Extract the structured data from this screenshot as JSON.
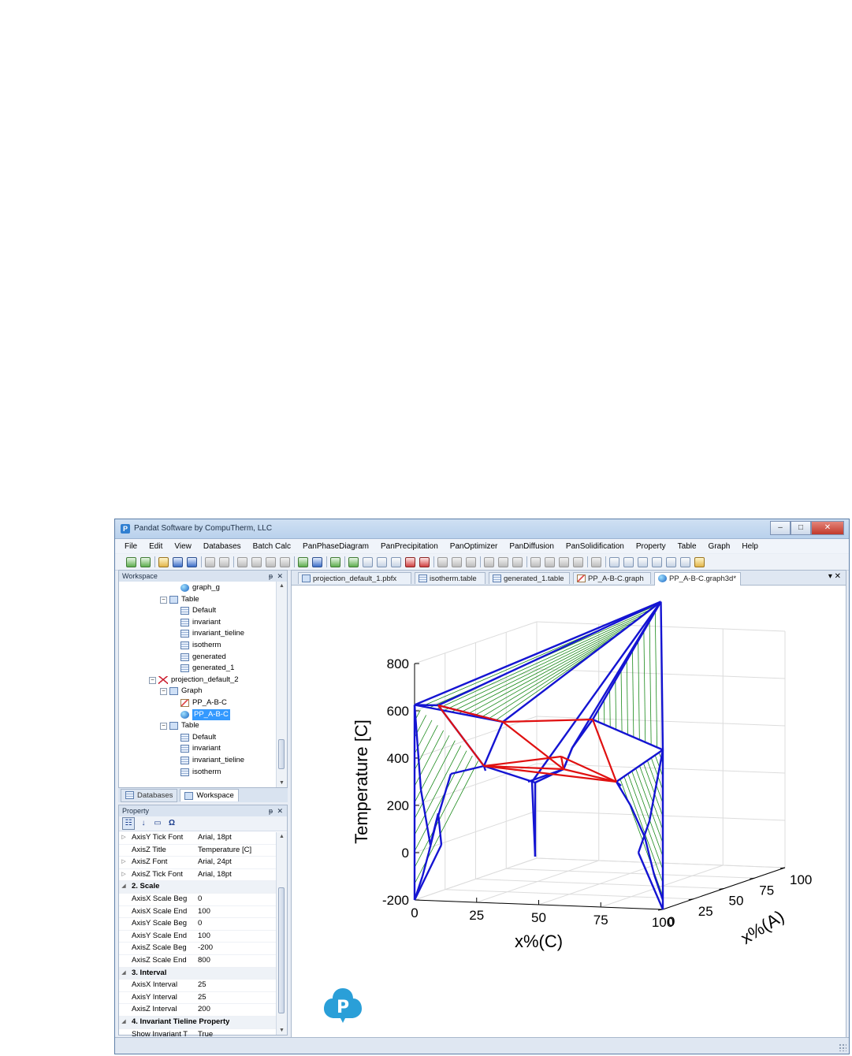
{
  "window": {
    "title": "Pandat Software by CompuTherm, LLC",
    "controls": {
      "minimize": "–",
      "maximize": "□",
      "close": "✕"
    }
  },
  "menu": [
    "File",
    "Edit",
    "View",
    "Databases",
    "Batch Calc",
    "PanPhaseDiagram",
    "PanPrecipitation",
    "PanOptimizer",
    "PanDiffusion",
    "PanSolidification",
    "Property",
    "Table",
    "Graph",
    "Help"
  ],
  "workspace": {
    "title": "Workspace",
    "pin": "ᵽ",
    "close": "✕",
    "tree": [
      {
        "label": "graph_g",
        "icon": "graph3d"
      },
      {
        "label": "Table",
        "icon": "folder"
      },
      {
        "label": "Default",
        "icon": "table"
      },
      {
        "label": "invariant",
        "icon": "table"
      },
      {
        "label": "invariant_tieline",
        "icon": "table"
      },
      {
        "label": "isotherm",
        "icon": "table"
      },
      {
        "label": "generated",
        "icon": "table"
      },
      {
        "label": "generated_1",
        "icon": "table"
      },
      {
        "label": "projection_default_2",
        "icon": "projection"
      },
      {
        "label": "Graph",
        "icon": "folder"
      },
      {
        "label": "PP_A-B-C",
        "icon": "graph"
      },
      {
        "label": "PP_A-B-C",
        "icon": "graph3d",
        "selected": true
      },
      {
        "label": "Table",
        "icon": "folder"
      },
      {
        "label": "Default",
        "icon": "table"
      },
      {
        "label": "invariant",
        "icon": "table"
      },
      {
        "label": "invariant_tieline",
        "icon": "table"
      },
      {
        "label": "isotherm",
        "icon": "table"
      }
    ]
  },
  "panel_tabs": [
    "Databases",
    "Workspace"
  ],
  "property": {
    "title": "Property",
    "pin": "ᵽ",
    "close": "✕",
    "rows": [
      {
        "type": "prop",
        "expand": true,
        "name": "AxisY Tick Font",
        "value": "Arial, 18pt"
      },
      {
        "type": "prop",
        "name": "AxisZ Title",
        "value": "Temperature [C]"
      },
      {
        "type": "prop",
        "expand": true,
        "name": "AxisZ Font",
        "value": "Arial, 24pt"
      },
      {
        "type": "prop",
        "expand": true,
        "name": "AxisZ Tick Font",
        "value": "Arial, 18pt"
      },
      {
        "type": "cat",
        "name": "2. Scale"
      },
      {
        "type": "prop",
        "name": "AxisX Scale Beg",
        "value": "0"
      },
      {
        "type": "prop",
        "name": "AxisX Scale End",
        "value": "100"
      },
      {
        "type": "prop",
        "name": "AxisY Scale Beg",
        "value": "0"
      },
      {
        "type": "prop",
        "name": "AxisY Scale End",
        "value": "100"
      },
      {
        "type": "prop",
        "name": "AxisZ Scale Beg",
        "value": "-200"
      },
      {
        "type": "prop",
        "name": "AxisZ Scale End",
        "value": "800"
      },
      {
        "type": "cat",
        "name": "3. Interval"
      },
      {
        "type": "prop",
        "name": "AxisX Interval",
        "value": "25"
      },
      {
        "type": "prop",
        "name": "AxisY Interval",
        "value": "25"
      },
      {
        "type": "prop",
        "name": "AxisZ Interval",
        "value": "200"
      },
      {
        "type": "cat",
        "name": "4. Invariant Tieline Property"
      },
      {
        "type": "prop",
        "name": "Show Invariant T",
        "value": "True"
      }
    ]
  },
  "doc_tabs": [
    {
      "label": "projection_default_1.pbfx",
      "icon": "download"
    },
    {
      "label": "isotherm.table",
      "icon": "table"
    },
    {
      "label": "generated_1.table",
      "icon": "table"
    },
    {
      "label": "PP_A-B-C.graph",
      "icon": "graph"
    },
    {
      "label": "PP_A-B-C.graph3d*",
      "icon": "graph3d",
      "active": true
    }
  ],
  "tab_controls": "▾ ✕",
  "chart_data": {
    "type": "line",
    "title": "",
    "zlabel": "Temperature [C]",
    "xlabel": "x%(C)",
    "ylabel": "x%(A)",
    "zticks": [
      "800",
      "600",
      "400",
      "200",
      "0",
      "-200"
    ],
    "xticks": [
      "0",
      "25",
      "50",
      "75",
      "100"
    ],
    "yticks": [
      "0",
      "25",
      "50",
      "75",
      "100"
    ],
    "xlim": [
      0,
      100
    ],
    "ylim": [
      0,
      100
    ],
    "zlim": [
      -200,
      800
    ],
    "colors": {
      "liquidus": "#1414d2",
      "invariant": "#e01010",
      "tieline": "#1a8a1a"
    },
    "series": [],
    "vertex_temperatures_approx": [
      625,
      900,
      475
    ]
  },
  "logo_letter": "P"
}
